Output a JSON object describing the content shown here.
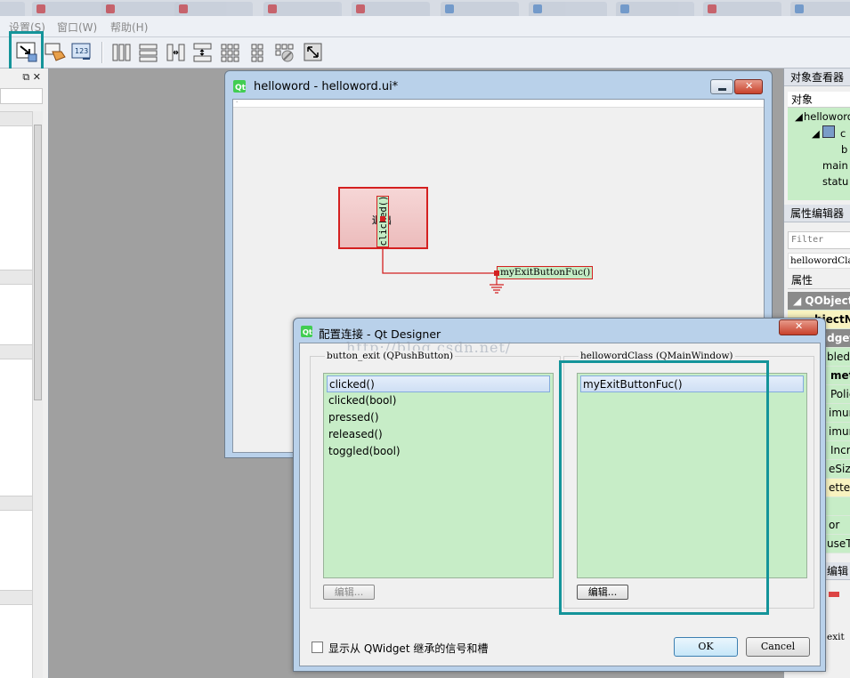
{
  "tabstrip": {
    "tabs": [
      "",
      "",
      "",
      "",
      "",
      "",
      "",
      "",
      "",
      "",
      ""
    ]
  },
  "menu": {
    "items": [
      "设置(S)",
      "窗口(W)",
      "帮助(H)"
    ]
  },
  "toolbar": {
    "icons": [
      "edit-signals-slots-icon",
      "edit-buddies-icon",
      "edit-tab-order-icon",
      "layout-horizontal-icon",
      "layout-vertical-icon",
      "layout-h-splitter-icon",
      "layout-v-splitter-icon",
      "layout-grid-icon",
      "layout-form-icon",
      "break-layout-icon",
      "adjust-size-icon"
    ]
  },
  "form_window": {
    "title": "helloword - helloword.ui*",
    "button_label": "退出",
    "signal_label": "clicked()",
    "slot_label": "myExitButtonFuc()"
  },
  "object_inspector": {
    "title": "对象查看器",
    "column": "对象",
    "tree": [
      "helloword",
      "c",
      "b",
      "main",
      "statu"
    ]
  },
  "property_editor": {
    "title": "属性编辑器",
    "filter_placeholder": "Filter",
    "class_line": "hellowordClass",
    "column": "属性",
    "rows": [
      "QObject",
      "bjectN",
      "idget",
      "bled",
      "met",
      "Polic",
      "imum",
      "imum",
      "Incre",
      "eSize",
      "ette",
      "or",
      "useTr",
      "编辑"
    ],
    "footer": "exit"
  },
  "dialog": {
    "title": "配置连接 - Qt Designer",
    "watermark": "http://blog.csdn.net/",
    "sender_group": "button_exit (QPushButton)",
    "sender_items": [
      "clicked()",
      "clicked(bool)",
      "pressed()",
      "released()",
      "toggled(bool)"
    ],
    "receiver_group": "hellowordClass (QMainWindow)",
    "receiver_items": [
      "myExitButtonFuc()"
    ],
    "edit_label": "编辑...",
    "inherit_label": "显示从 QWidget 继承的信号和槽",
    "ok_label": "OK",
    "cancel_label": "Cancel"
  },
  "colors": {
    "highlight": "#14949a",
    "connection": "#d42020",
    "list_bg": "#c7edc7"
  }
}
